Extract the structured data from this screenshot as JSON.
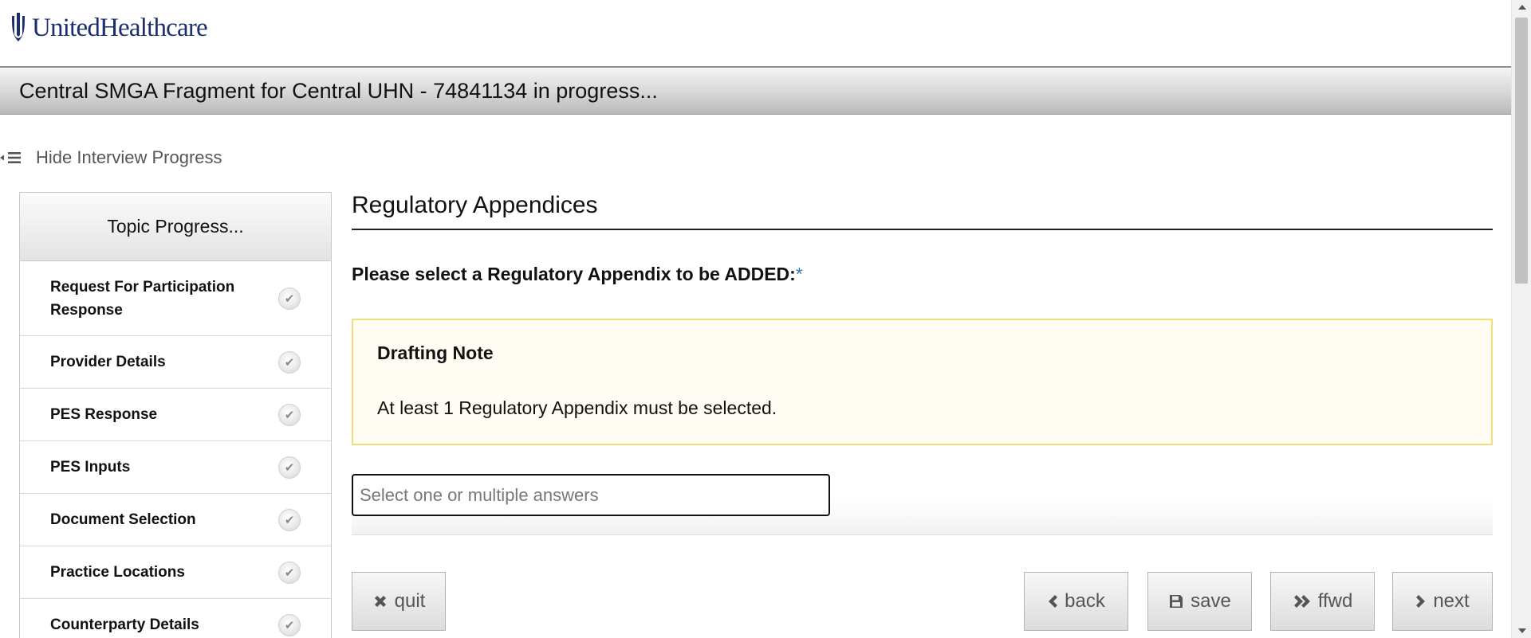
{
  "brand": {
    "logo_text": "UnitedHealthcare",
    "logo_color": "#1b2f6e"
  },
  "titlebar": {
    "title": "Central SMGA Fragment for Central UHN - 74841134 in progress..."
  },
  "progress_toggle": {
    "label": "Hide Interview Progress",
    "icon": "collapse-menu-icon"
  },
  "sidebar": {
    "header": "Topic Progress...",
    "items": [
      {
        "label": "Request For Participation Response",
        "status_icon": "check-icon"
      },
      {
        "label": "Provider Details",
        "status_icon": "check-icon"
      },
      {
        "label": "PES Response",
        "status_icon": "check-icon"
      },
      {
        "label": "PES Inputs",
        "status_icon": "check-icon"
      },
      {
        "label": "Document Selection",
        "status_icon": "check-icon"
      },
      {
        "label": "Practice Locations",
        "status_icon": "check-icon"
      },
      {
        "label": "Counterparty Details",
        "status_icon": "check-icon"
      }
    ]
  },
  "main": {
    "section_title": "Regulatory Appendices",
    "question": "Please select a Regulatory Appendix to be ADDED",
    "question_suffix": ":",
    "required_marker": "*",
    "note": {
      "title": "Drafting Note",
      "body": "At least 1 Regulatory Appendix must be selected."
    },
    "answer": {
      "value": "",
      "placeholder": "Select one or multiple answers"
    }
  },
  "buttons": {
    "quit": "quit",
    "back": "back",
    "save": "save",
    "ffwd": "ffwd",
    "next": "next"
  },
  "colors": {
    "note_background": "#fffdf3",
    "note_border": "#f3dc7b",
    "required_marker": "#2a7ab8"
  }
}
